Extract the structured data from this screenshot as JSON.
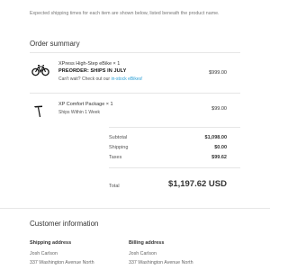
{
  "intro_text": "Expected shipping times for each item are shown below, listed beneath the product name.",
  "order_summary": {
    "title": "Order summary",
    "items": [
      {
        "name": "XPress High-Step eBike × 1",
        "preorder": "PREORDER: SHIPS IN JULY",
        "note_prefix": "Can't wait? Check out our ",
        "note_link": "in-stock eBikes!",
        "price": "$999.00",
        "icon": "bike-icon"
      },
      {
        "name": "XP Comfort Package × 1",
        "shipping": "Ships Within 1 Week",
        "price": "$99.00",
        "icon": "bike-seat-icon"
      }
    ],
    "subtotal_label": "Subtotal",
    "subtotal_value": "$1,098.00",
    "shipping_label": "Shipping",
    "shipping_value": "$0.00",
    "taxes_label": "Taxes",
    "taxes_value": "$99.62",
    "total_label": "Total",
    "total_value": "$1,197.62 USD"
  },
  "customer_info": {
    "title": "Customer information",
    "shipping_address": {
      "heading": "Shipping address",
      "name": "Josh Carlson",
      "street": "337 Washington Avenue North"
    },
    "billing_address": {
      "heading": "Billing address",
      "name": "Josh Carlson",
      "street": "337 Washington Avenue North"
    }
  },
  "colors": {
    "link": "#2a9fd6",
    "text": "#333333",
    "muted": "#777777"
  }
}
